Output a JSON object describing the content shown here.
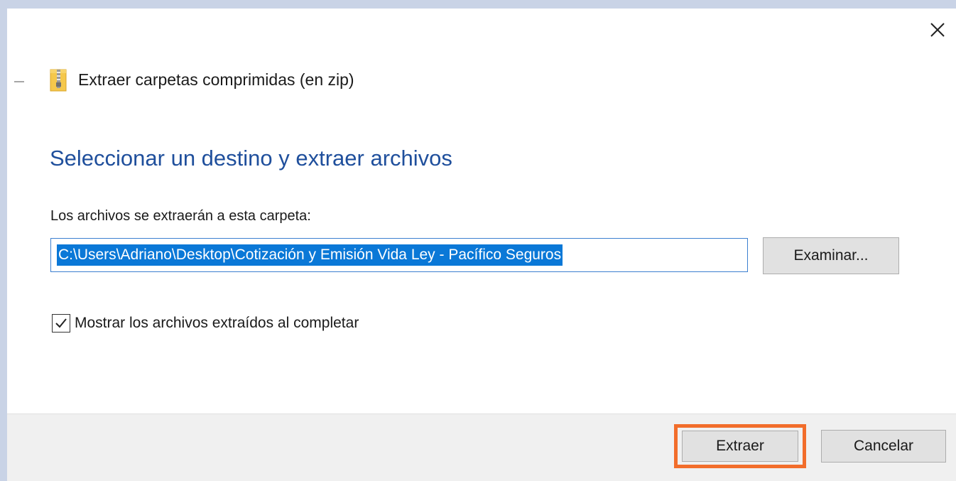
{
  "window": {
    "title": "Extraer carpetas comprimidas (en zip)",
    "title_icon": "zip-folder-icon",
    "close_icon": "close-icon"
  },
  "main": {
    "heading": "Seleccionar un destino y extraer archivos",
    "destination_label": "Los archivos se extraerán a esta carpeta:",
    "destination_path": "C:\\Users\\Adriano\\Desktop\\Cotización y Emisión Vida Ley - Pacífico Seguros",
    "browse_label": "Examinar...",
    "show_files_label": "Mostrar los archivos extraídos al completar",
    "show_files_checked": true
  },
  "footer": {
    "extract_label": "Extraer",
    "cancel_label": "Cancelar",
    "highlight_color": "#f26d2b"
  },
  "colors": {
    "heading": "#1f4f9c",
    "selection": "#0a78d7",
    "footer_bg": "#f0f0f0"
  }
}
